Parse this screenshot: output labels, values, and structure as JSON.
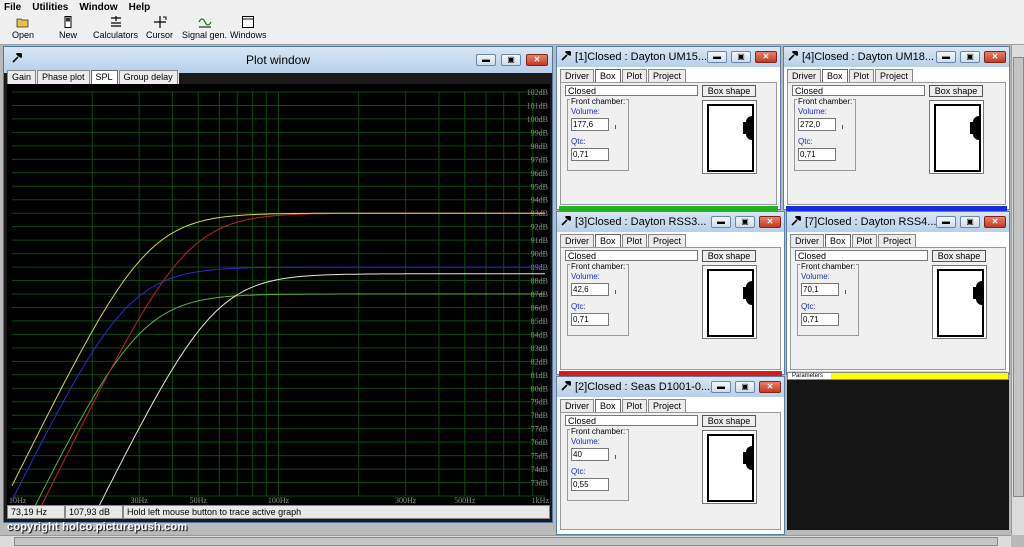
{
  "menu": [
    "File",
    "Utilities",
    "Window",
    "Help"
  ],
  "toolbar": [
    {
      "label": "Open",
      "icon": "open-folder-icon"
    },
    {
      "label": "New",
      "icon": "new-document-icon"
    },
    {
      "label": "Calculators",
      "icon": "calculator-icon"
    },
    {
      "label": "Cursor",
      "icon": "cursor-icon"
    },
    {
      "label": "Signal gen.",
      "icon": "signal-generator-icon"
    },
    {
      "label": "Windows",
      "icon": "windows-icon"
    }
  ],
  "plot": {
    "title": "Plot window",
    "tabs": [
      "Gain",
      "Phase plot",
      "SPL",
      "Group delay"
    ],
    "selected_tab": "SPL",
    "status": {
      "freq": "73,19 Hz",
      "level": "107,93 dB",
      "hint": "Hold left mouse button to trace active graph"
    }
  },
  "chart_data": {
    "type": "line",
    "x_scale": "log",
    "xlim": [
      10,
      1000
    ],
    "ylim": [
      72,
      102
    ],
    "y_ticks": [
      "102dB",
      "101dB",
      "100dB",
      "99dB",
      "98dB",
      "97dB",
      "96dB",
      "95dB",
      "94dB",
      "93dB",
      "92dB",
      "91dB",
      "90dB",
      "89dB",
      "88dB",
      "87dB",
      "86dB",
      "85dB",
      "84dB",
      "83dB",
      "82dB",
      "81dB",
      "80dB",
      "79dB",
      "78dB",
      "77dB",
      "76dB",
      "75dB",
      "74dB",
      "73dB"
    ],
    "x_ticks": [
      "10Hz",
      "30Hz",
      "50Hz",
      "100Hz",
      "300Hz",
      "500Hz",
      "1kHz"
    ],
    "series": [
      {
        "color": "#5ab03a",
        "fc": 30,
        "level": 87
      },
      {
        "color": "#2a2ad8",
        "fc": 27,
        "level": 89
      },
      {
        "color": "#c4231e",
        "fc": 45,
        "level": 93
      },
      {
        "color": "#d8d84a",
        "fc": 32,
        "level": 93
      },
      {
        "color": "#e8e8d0",
        "fc": 57,
        "level": 88.5
      }
    ]
  },
  "enclosures": [
    {
      "title": "[1]Closed : Dayton UM15...",
      "tabs": [
        "Driver",
        "Box",
        "Plot",
        "Project"
      ],
      "type": "Closed",
      "box_shape": "Box shape",
      "front_chamber": "Front chamber:",
      "volume_label": "Volume:",
      "volume": "177,6",
      "qtc_label": "Qtc:",
      "qtc": "0,71",
      "color": "#22b322"
    },
    {
      "title": "[4]Closed : Dayton UM18...",
      "tabs": [
        "Driver",
        "Box",
        "Plot",
        "Project"
      ],
      "type": "Closed",
      "box_shape": "Box shape",
      "front_chamber": "Front chamber:",
      "volume_label": "Volume:",
      "volume": "272,0",
      "qtc_label": "Qtc:",
      "qtc": "0,71",
      "color": "#1a2ae0"
    },
    {
      "title": "[3]Closed : Dayton RSS3...",
      "tabs": [
        "Driver",
        "Box",
        "Plot",
        "Project"
      ],
      "type": "Closed",
      "box_shape": "Box shape",
      "front_chamber": "Front chamber:",
      "volume_label": "Volume:",
      "volume": "42,6",
      "qtc_label": "Qtc:",
      "qtc": "0,71",
      "color": "#d81a1a"
    },
    {
      "title": "[7]Closed : Dayton RSS4...",
      "tabs": [
        "Driver",
        "Box",
        "Plot",
        "Project"
      ],
      "type": "Closed",
      "box_shape": "Box shape",
      "front_chamber": "Front chamber:",
      "volume_label": "Volume:",
      "volume": "70,1",
      "qtc_label": "Qtc:",
      "qtc": "0,71",
      "color": "#f0f010"
    },
    {
      "title": "[2]Closed : Seas D1001-0...",
      "tabs": [
        "Driver",
        "Box",
        "Plot",
        "Project"
      ],
      "type": "Closed",
      "box_shape": "Box shape",
      "front_chamber": "Front chamber:",
      "volume_label": "Volume:",
      "volume": "40",
      "qtc_label": "Qtc:",
      "qtc": "0,55",
      "color": ""
    }
  ],
  "parameters_label": "Parameters",
  "copyright": "copyright holco.picturepush.com"
}
